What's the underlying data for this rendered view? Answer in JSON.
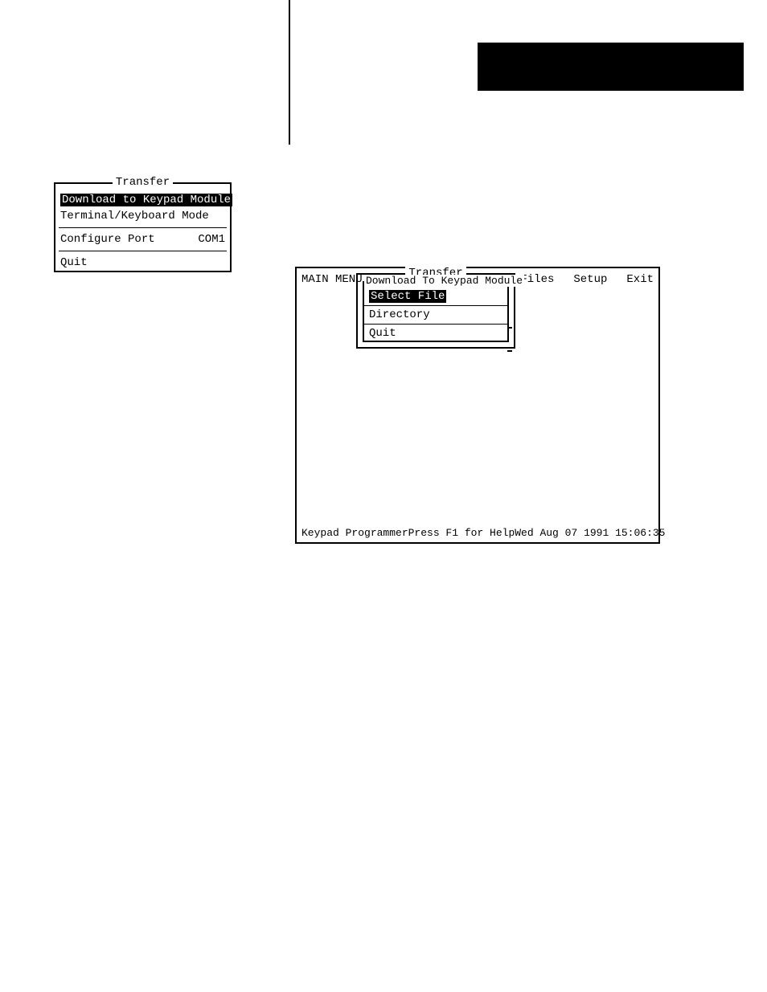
{
  "upper": {},
  "transfer_frame": {
    "title": "Transfer",
    "download_label": "Download to Keypad Module",
    "terminal_label": "Terminal/Keyboard Mode",
    "configure_label": "Configure Port",
    "configure_value": "COM1",
    "quit_label": "Quit"
  },
  "main": {
    "menubar": {
      "main_menu": "MAIN MENU:",
      "files": "Files",
      "setup": "Setup",
      "exit": "Exit"
    },
    "inner_transfer_title": "Transfer",
    "inner_download": {
      "title": "Download To Keypad Module",
      "select_file": "Select File",
      "directory": "Directory",
      "quit": "Quit"
    },
    "status": {
      "left": "Keypad Programmer",
      "mid": "Press F1 for Help",
      "right": "Wed Aug 07 1991 15:06:35"
    }
  }
}
